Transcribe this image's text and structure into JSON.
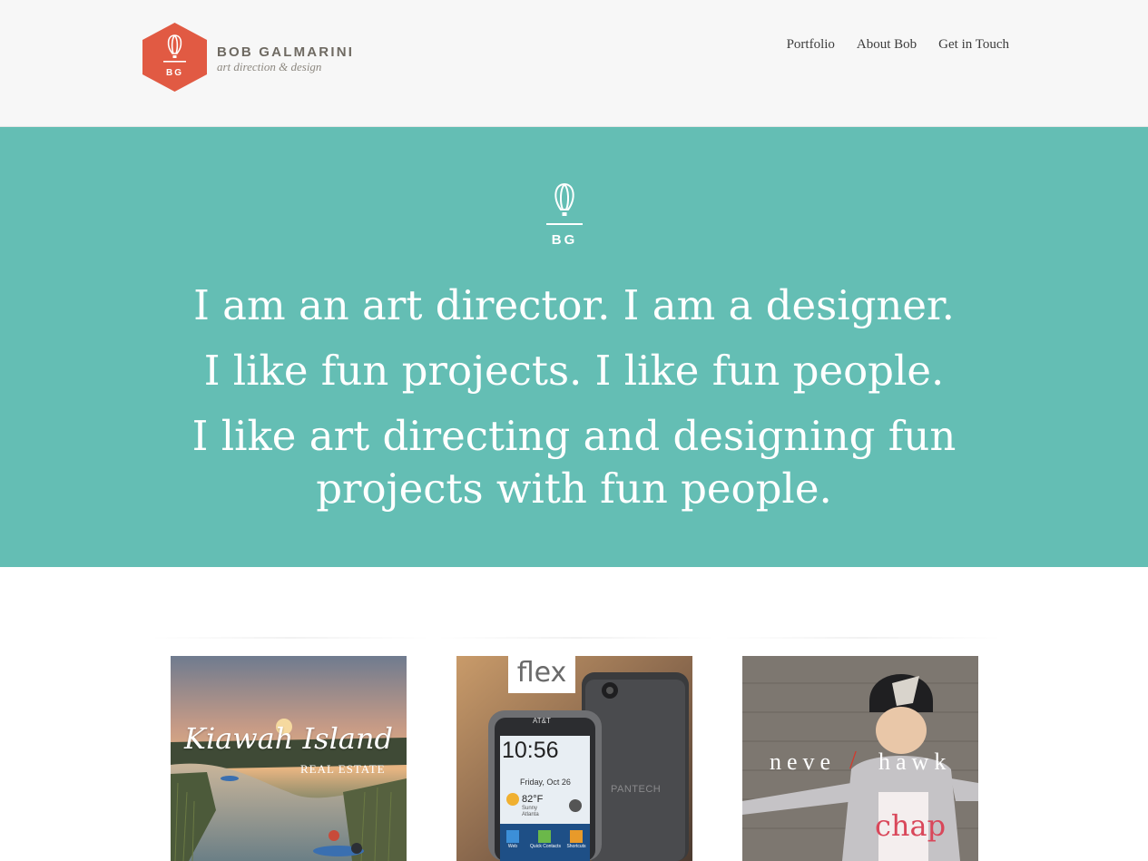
{
  "brand": {
    "logo_initials": "BG",
    "name": "BOB GALMARINI",
    "tagline": "art direction & design"
  },
  "nav": {
    "items": [
      {
        "label": "Portfolio"
      },
      {
        "label": "About Bob"
      },
      {
        "label": "Get in Touch"
      }
    ]
  },
  "hero": {
    "emblem_initials": "BG",
    "lines": [
      "I am an art director. I am a designer.",
      "I like fun projects. I like fun people.",
      "I like art directing and designing fun projects with fun people."
    ]
  },
  "portfolio": {
    "tiles": [
      {
        "title": "Kiawah Island",
        "subtitle": "REAL ESTATE"
      },
      {
        "brand": "flex",
        "carrier": "AT&T",
        "time": "10:56",
        "date": "Friday, Oct 26",
        "temp": "82°F",
        "weather": "Sunny",
        "city": "Atlanta",
        "device": "PANTECH",
        "apps": [
          "Web",
          "Quick Contacts",
          "Shortcuts"
        ]
      },
      {
        "left": "neve",
        "slash": "/",
        "right": "hawk",
        "shirt": "chap"
      }
    ]
  },
  "colors": {
    "header_bg": "#f7f7f7",
    "logo_red": "#e15a43",
    "hero_teal": "#64beb4",
    "slash_red": "#d23a2e"
  },
  "icons": [
    "hot-air-balloon-icon"
  ]
}
